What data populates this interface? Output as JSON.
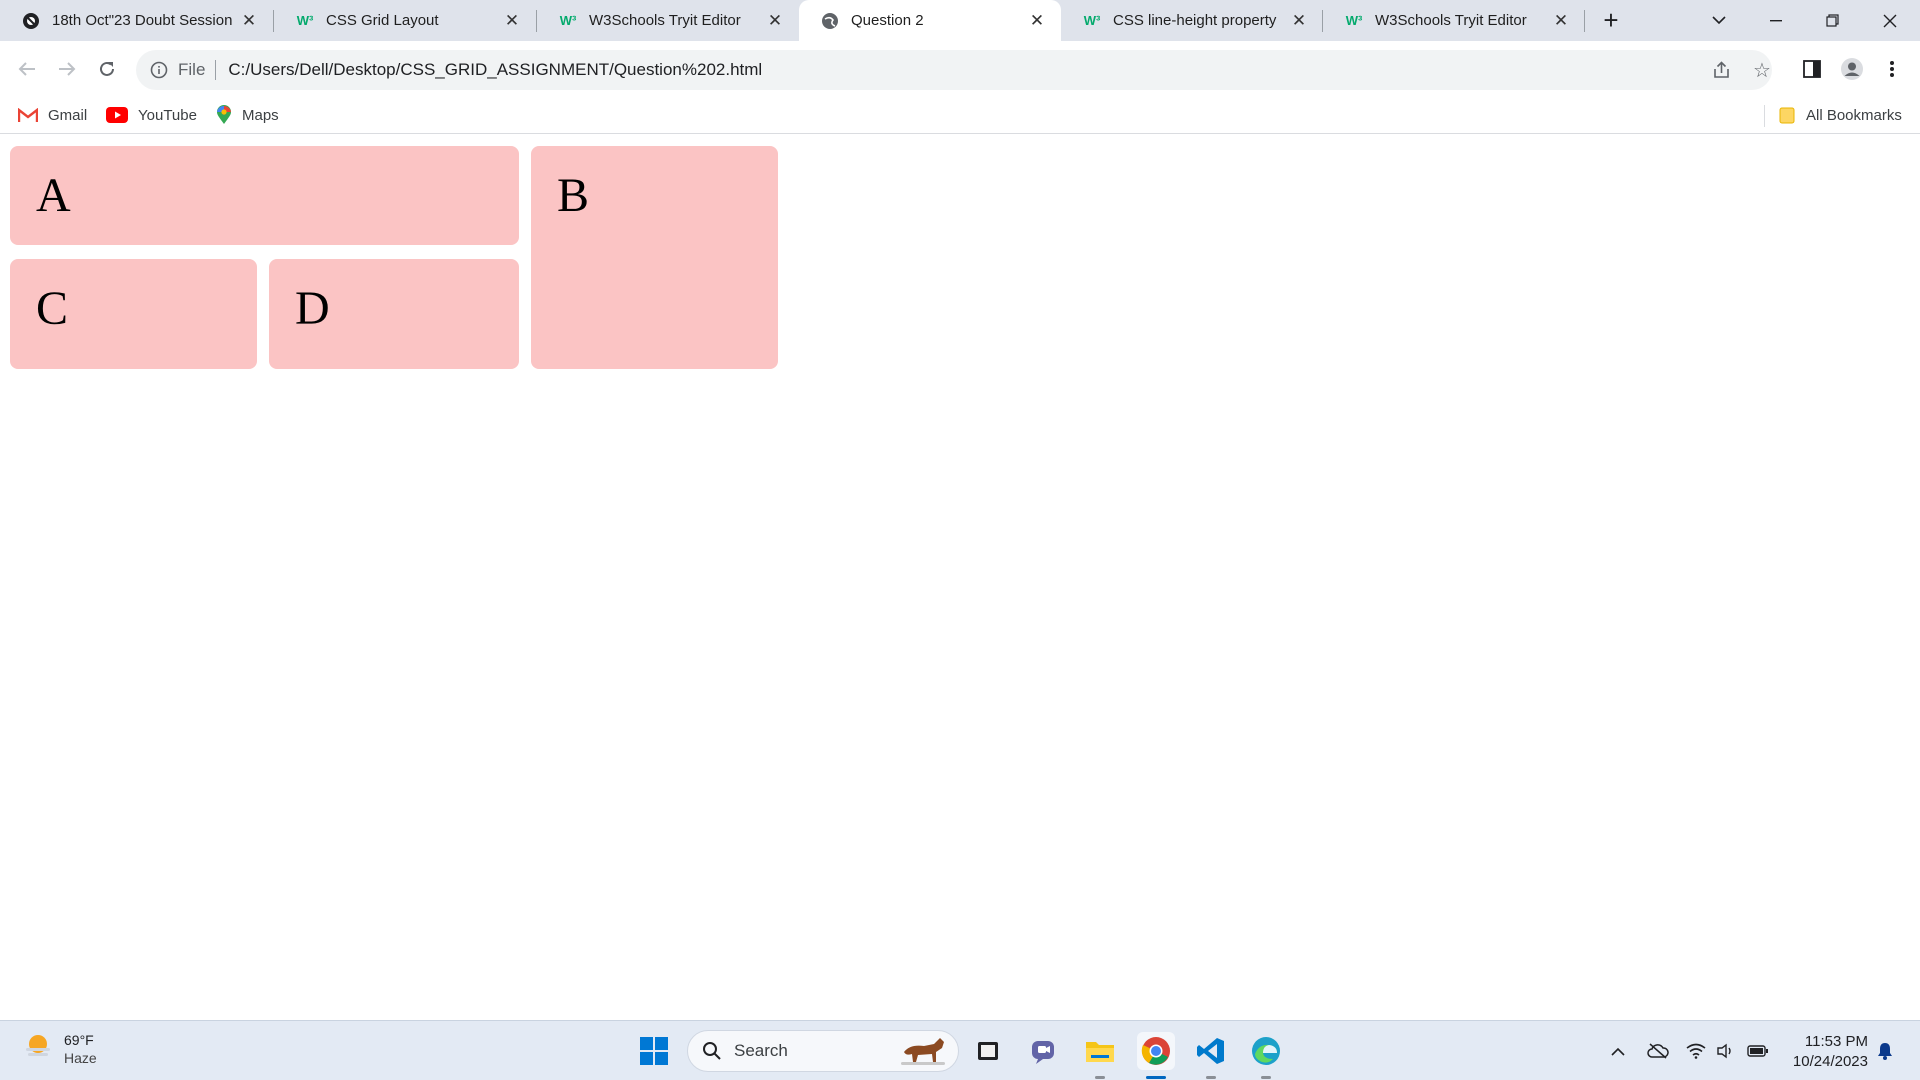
{
  "tabs": [
    {
      "title": "18th Oct\"23 Doubt Session",
      "icon": "site-icon"
    },
    {
      "title": "CSS Grid Layout",
      "icon": "w3schools-icon"
    },
    {
      "title": "W3Schools Tryit Editor",
      "icon": "w3schools-icon"
    },
    {
      "title": "Question 2",
      "icon": "globe-icon",
      "active": true
    },
    {
      "title": "CSS line-height property",
      "icon": "w3schools-icon"
    },
    {
      "title": "W3Schools Tryit Editor",
      "icon": "w3schools-icon"
    }
  ],
  "address": {
    "scheme": "File",
    "url": "C:/Users/Dell/Desktop/CSS_GRID_ASSIGNMENT/Question%202.html"
  },
  "bookmarks": {
    "gmail": "Gmail",
    "youtube": "YouTube",
    "maps": "Maps",
    "all": "All Bookmarks"
  },
  "grid": {
    "a": "A",
    "b": "B",
    "c": "C",
    "d": "D"
  },
  "taskbar": {
    "temperature": "69°F",
    "weather": "Haze",
    "search_placeholder": "Search",
    "time": "11:53 PM",
    "date": "10/24/2023"
  },
  "colors": {
    "cell_bg": "#fbc4c4",
    "tabstrip_bg": "#dfe3eb",
    "w3_green": "#04aa6d"
  }
}
